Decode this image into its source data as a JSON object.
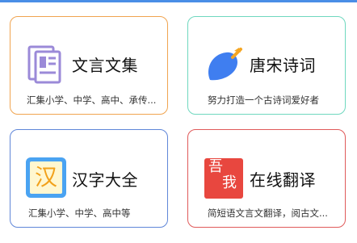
{
  "cards": [
    {
      "title": "文言文集",
      "description": "汇集小学、中学、高中、承传...",
      "icon": "document-stack-icon",
      "border_color": "#f0a450"
    },
    {
      "title": "唐宋诗词",
      "description": "努力打造一个古诗词爱好者",
      "icon": "leaf-icon",
      "border_color": "#6fd8bf"
    },
    {
      "title": "汉字大全",
      "description": "汇集小学、中学、高中等",
      "icon": "hanzi-icon",
      "icon_glyph": "汉",
      "border_color": "#5f86d8"
    },
    {
      "title": "在线翻译",
      "description": "简短语文言文翻译，阅古文...",
      "icon": "translate-seal-icon",
      "icon_glyphs": [
        "吾",
        "我"
      ],
      "border_color": "#e05a5a"
    }
  ]
}
